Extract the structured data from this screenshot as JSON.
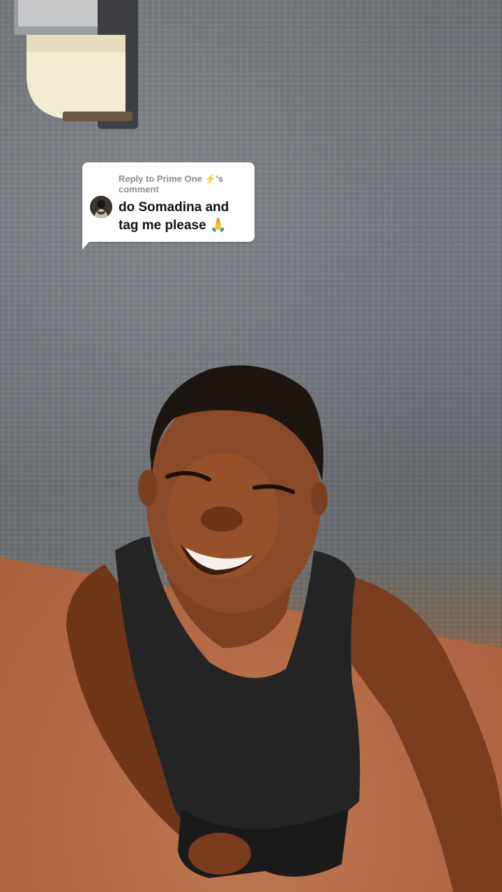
{
  "reply_sticker": {
    "prefix": "Reply to ",
    "username": "Prime One",
    "username_emoji": "⚡",
    "suffix": "'s comment",
    "comment_line1": "do Somadina and",
    "comment_line2": "tag me please 🙏",
    "avatar_icon": "user-avatar-icon"
  },
  "colors": {
    "sticker_bg": "#ffffff",
    "sticker_header": "#8a8b91",
    "sticker_text": "#111111",
    "bolt": "#f3b400"
  }
}
